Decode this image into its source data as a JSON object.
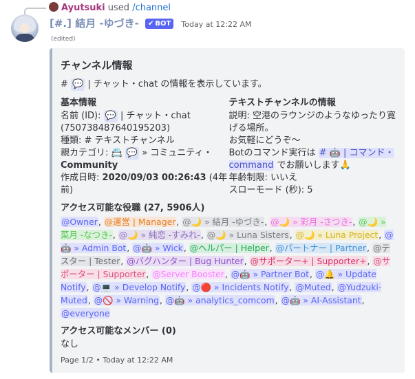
{
  "reply": {
    "user": "Ayutsuki",
    "used": "used",
    "command": "/channel"
  },
  "message": {
    "username": "[#.] 結月 -ゆづき-",
    "bot_badge": "BOT",
    "timestamp": "Today at 12:22 AM",
    "edited": "(edited)"
  },
  "embed": {
    "title": "チャンネル情報",
    "description": {
      "hash": "#",
      "icon": "💬",
      "text": "| チャット・chat の情報を表示しています。"
    },
    "basic": {
      "title": "基本情報",
      "name_label": "名前 (ID):",
      "name_icon": "💬",
      "name_value": "| チャット・chat",
      "id": "(750738487640195203)",
      "type_label": "種類:",
      "type_value": "# テキストチャンネル",
      "parent_label": "親カテゴリ:",
      "parent_icon": "📇",
      "parent_icon2": "💬",
      "parent_value": "» コミュニティ・",
      "parent_value2": "Community",
      "created_label": "作成日時:",
      "created_value": "2020/09/03 00:26:43",
      "created_rel": "(4年前)"
    },
    "text_channel": {
      "title": "テキストチャンネルの情報",
      "desc_line": "説明: 空港のラウンジのようなゆったり寛げる場所。",
      "desc_line2": "お気軽にどうぞ～",
      "cmd_prefix": "Botのコマンド実行は",
      "cmd_mention": "# 🤖 | コマンド・command",
      "cmd_suffix": "でお願いします🙏",
      "age": "年齢制限: いいえ",
      "slowmode": "スローモード (秒): 5"
    },
    "roles_title": "アクセス可能な役職 (27, 5906人)",
    "roles": [
      {
        "label": "@Owner",
        "color": "#5865f2",
        "bg": "#dee0fc"
      },
      {
        "label": "@運営 | Manager",
        "color": "#e67e22",
        "bg": "#f8e6d8"
      },
      {
        "label": "@🌙 » 結月 -ゆづき-",
        "color": "#7d7f87",
        "bg": "#e4e5e8"
      },
      {
        "label": "@🌙 » 彩月 -さつき-",
        "color": "#e96ed8",
        "bg": "#f6dcf3"
      },
      {
        "label": "@🌙 » 菜月 -なつき-",
        "color": "#57c754",
        "bg": "#dcf1dc"
      },
      {
        "label": "@🌙 » 純恋 -すみれ-",
        "color": "#8e6fbf",
        "bg": "#e5dff0"
      },
      {
        "label": "@🌙 » Luna Sisters",
        "color": "#7a7c84",
        "bg": "#e4e5e8"
      },
      {
        "label": "@🌙 » Luna Project",
        "color": "#d4b31e",
        "bg": "#f4efcd"
      },
      {
        "label": "@🤖 » Admin Bot",
        "color": "#5865f2",
        "bg": "#dee0fc"
      },
      {
        "label": "@🤖 » Wick",
        "color": "#5865f2",
        "bg": "#dee0fc"
      },
      {
        "label": "@ヘルパー | Helper",
        "color": "#1fa855",
        "bg": "#d6efde"
      },
      {
        "label": "@パートナー | Partner",
        "color": "#3c8fd8",
        "bg": "#d8e7f5"
      },
      {
        "label": "@テスター | Tester",
        "color": "#6a6c74",
        "bg": "#e4e5e8"
      },
      {
        "label": "@バグハンター | Bug Hunter",
        "color": "#8c4fc4",
        "bg": "#e8dcf4"
      },
      {
        "label": "@サポーター+ | Supporter+",
        "color": "#d6336c",
        "bg": "#f7dbe5"
      },
      {
        "label": "@サポーター | Supporter",
        "color": "#d94f7c",
        "bg": "#f7dee7"
      },
      {
        "label": "@Server Booster",
        "color": "#f47fff",
        "bg": "#fae2fc"
      },
      {
        "label": "@🤖 » Partner Bot",
        "color": "#5865f2",
        "bg": "#dee0fc"
      },
      {
        "label": "@🔔 » Update Notify",
        "color": "#5865f2",
        "bg": "#dee0fc"
      },
      {
        "label": "@💻 » Develop Notify",
        "color": "#5865f2",
        "bg": "#dee0fc"
      },
      {
        "label": "@🔴 » Incidents Notify",
        "color": "#5865f2",
        "bg": "#dee0fc"
      },
      {
        "label": "@Muted",
        "color": "#5865f2",
        "bg": "#dee0fc"
      },
      {
        "label": "@Yudzuki-Muted",
        "color": "#5865f2",
        "bg": "#dee0fc"
      },
      {
        "label": "@🚫 » Warning",
        "color": "#5865f2",
        "bg": "#dee0fc"
      },
      {
        "label": "@🤖 » analytics_comcom",
        "color": "#5865f2",
        "bg": "#dee0fc"
      },
      {
        "label": "@🤖 » AI-Assistant",
        "color": "#5865f2",
        "bg": "#dee0fc"
      },
      {
        "label": "@everyone",
        "color": "#5865f2",
        "bg": "#dee0fc"
      }
    ],
    "members_title": "アクセス可能なメンバー (0)",
    "members_value": "なし",
    "footer": "Page 1/2 • Today at 12:22 AM"
  },
  "colors": {
    "embed_border": "#a7b2c7",
    "embed_bg": "#f2f3f5",
    "bot_badge": "#5865f2",
    "mention_bg": "#dee0fc"
  }
}
